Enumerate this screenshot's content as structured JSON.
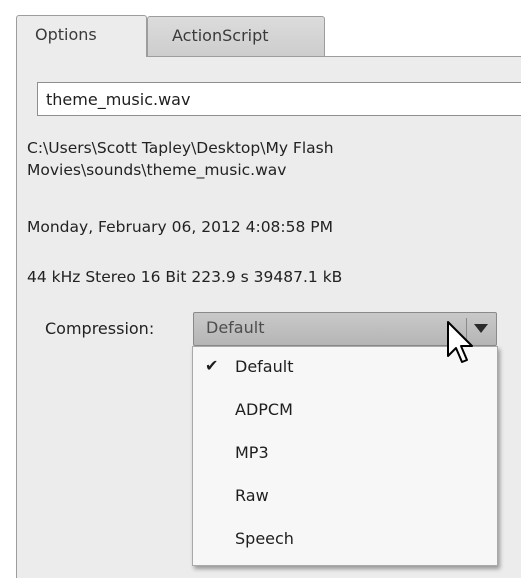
{
  "tabs": [
    {
      "label": "Options",
      "active": true
    },
    {
      "label": "ActionScript",
      "active": false
    }
  ],
  "file": {
    "name": "theme_music.wav",
    "path": "C:\\Users\\Scott Tapley\\Desktop\\My Flash Movies\\sounds\\theme_music.wav",
    "date": "Monday, February 06, 2012  4:08:58 PM",
    "format": "44 kHz Stereo 16 Bit 223.9 s 39487.1 kB"
  },
  "compression": {
    "label": "Compression:",
    "selected": "Default",
    "options": [
      "Default",
      "ADPCM",
      "MP3",
      "Raw",
      "Speech"
    ]
  },
  "icons": {
    "check": "checkmark-icon",
    "chevron": "chevron-down-icon",
    "cursor": "mouse-pointer-icon"
  },
  "colors": {
    "panel_bg": "#ececec",
    "select_bg": "#c0c0c0",
    "menu_bg": "#f7f7f7"
  }
}
